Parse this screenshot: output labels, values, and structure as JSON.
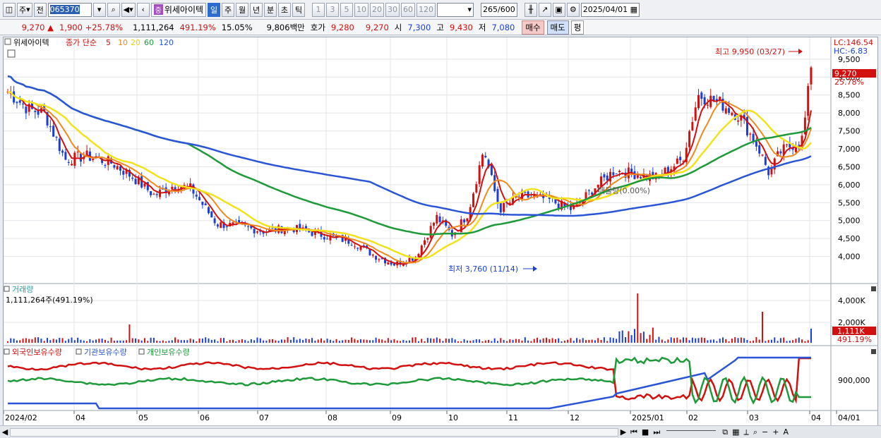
{
  "toolbar": {
    "market_dropdown": "주",
    "type_dropdown": "전",
    "code": "065370",
    "tag": "중",
    "stock_name": "위세아이텍",
    "period_buttons": [
      "일",
      "주",
      "월",
      "년",
      "분",
      "초",
      "틱"
    ],
    "minute_buttons": [
      "1",
      "3",
      "5",
      "10",
      "20",
      "30",
      "60",
      "120"
    ],
    "count": "265",
    "count_total": "/600",
    "date": "2025/04/01"
  },
  "quote": {
    "price": "9,270 ▲",
    "change": "1,900 +25.78%",
    "volume": "1,111,264",
    "vol_ratio": "491.19%",
    "turnover": "15.05%",
    "amount": "9,806백만",
    "bid_label": "호가",
    "bid": "9,280",
    "ask": "9,270",
    "open_label": "시",
    "open": "7,300",
    "high_label": "고",
    "high": "9,430",
    "low_label": "저",
    "low": "7,080",
    "buy_label": "매수",
    "sell_label": "매도",
    "eval_label": "평"
  },
  "price_panel": {
    "stock": "위세아이텍",
    "ma_label": "종가 단순",
    "ma_periods": [
      "5",
      "10",
      "20",
      "60",
      "120"
    ],
    "ma_colors": [
      "#d21010",
      "#f08a1c",
      "#f2e21a",
      "#1e9a3a",
      "#2a55d6"
    ],
    "lc": "LC:146.54",
    "hc": "HC:-6.83",
    "high_note": "최고 9,950 (03/27)",
    "low_note": "최저 3,760 (11/14)",
    "overlay_note": "매물량(0.00%)",
    "y_ticks": [
      "9,500",
      "9,000",
      "8,500",
      "8,000",
      "7,500",
      "7,000",
      "6,500",
      "6,000",
      "5,500",
      "5,000",
      "4,500",
      "4,000"
    ],
    "last_price": "9,270",
    "last_change": "25.78%"
  },
  "volume_panel": {
    "title": "거래량",
    "value": "1,111,264주(491.19%)",
    "y_ticks": [
      "4,000K",
      "2,000K"
    ],
    "last_volume": "1,111K",
    "last_ratio": "491.19%"
  },
  "holding_panel": {
    "series": [
      "외국인보유수량",
      "기관보유수량",
      "개인보유수량"
    ],
    "colors": [
      "#d21010",
      "#2a55d6",
      "#1e9a3a"
    ],
    "y_tick": "900,000"
  },
  "x_axis": [
    "2024/02",
    "04",
    "05",
    "06",
    "07",
    "08",
    "09",
    "10",
    "11",
    "12",
    "2025/01",
    "02",
    "03",
    "04",
    "04/01"
  ]
}
